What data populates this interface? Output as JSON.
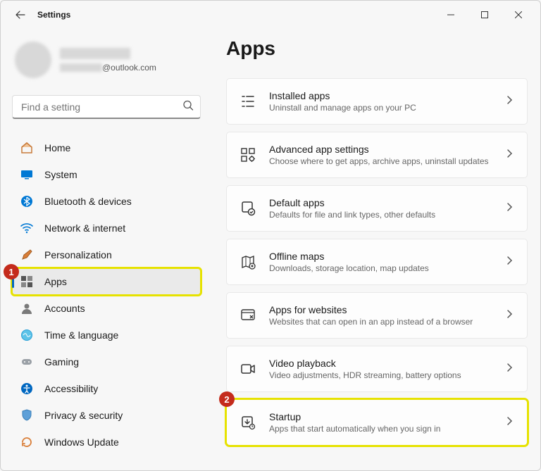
{
  "window": {
    "title": "Settings"
  },
  "profile": {
    "email_suffix": "@outlook.com"
  },
  "search": {
    "placeholder": "Find a setting"
  },
  "nav": {
    "home": "Home",
    "system": "System",
    "bluetooth": "Bluetooth & devices",
    "network": "Network & internet",
    "personalization": "Personalization",
    "apps": "Apps",
    "accounts": "Accounts",
    "time": "Time & language",
    "gaming": "Gaming",
    "accessibility": "Accessibility",
    "privacy": "Privacy & security",
    "update": "Windows Update"
  },
  "page": {
    "title": "Apps"
  },
  "cards": {
    "installed": {
      "title": "Installed apps",
      "sub": "Uninstall and manage apps on your PC"
    },
    "advanced": {
      "title": "Advanced app settings",
      "sub": "Choose where to get apps, archive apps, uninstall updates"
    },
    "default": {
      "title": "Default apps",
      "sub": "Defaults for file and link types, other defaults"
    },
    "offline": {
      "title": "Offline maps",
      "sub": "Downloads, storage location, map updates"
    },
    "websites": {
      "title": "Apps for websites",
      "sub": "Websites that can open in an app instead of a browser"
    },
    "video": {
      "title": "Video playback",
      "sub": "Video adjustments, HDR streaming, battery options"
    },
    "startup": {
      "title": "Startup",
      "sub": "Apps that start automatically when you sign in"
    }
  },
  "callouts": {
    "one": "1",
    "two": "2"
  }
}
